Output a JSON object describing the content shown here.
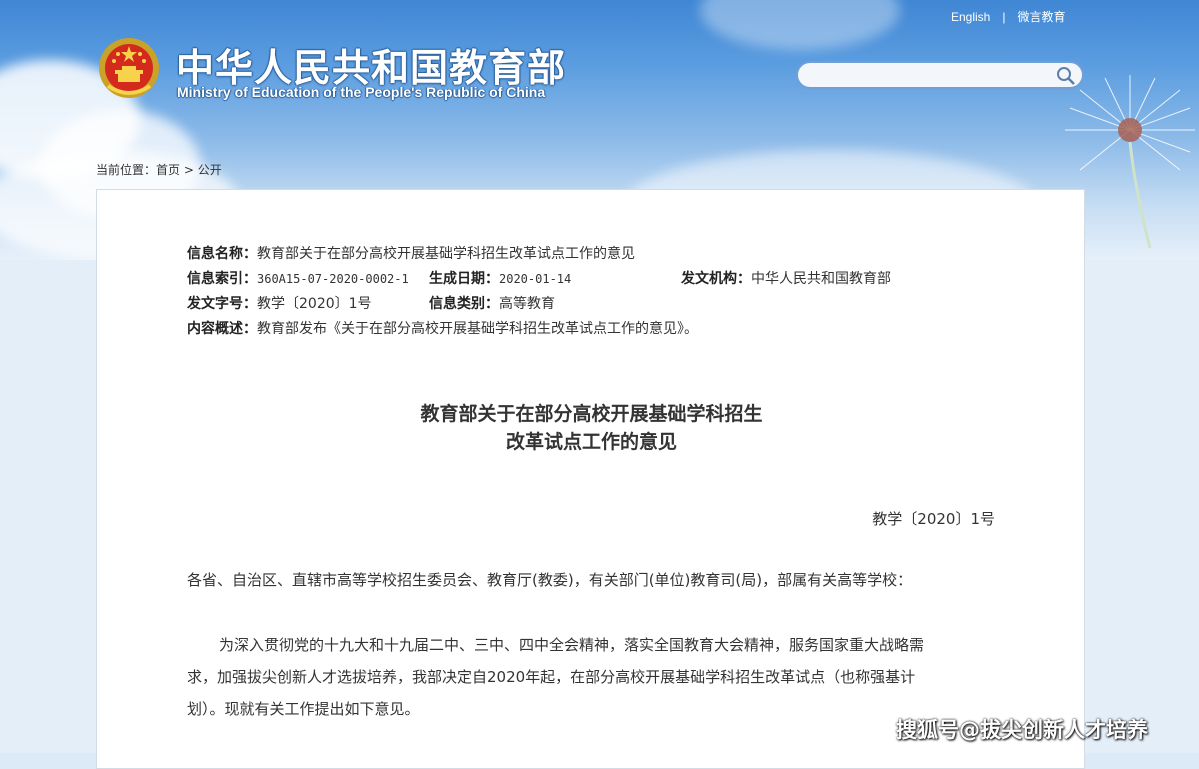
{
  "header": {
    "title_cn": "中华人民共和国教育部",
    "title_en": "Ministry of Education of the People's Republic of China",
    "links": {
      "english": "English",
      "separator": "|",
      "weixin": "微言教育"
    },
    "search": {
      "placeholder": "",
      "icon": "search-icon"
    }
  },
  "breadcrumb": {
    "prefix": "当前位置：",
    "home": "首页",
    "sep": ">",
    "current": "公开"
  },
  "meta": {
    "name_label": "信息名称：",
    "name_value": "教育部关于在部分高校开展基础学科招生改革试点工作的意见",
    "index_label": "信息索引：",
    "index_value": "360A15-07-2020-0002-1",
    "date_label": "生成日期：",
    "date_value": "2020-01-14",
    "org_label": "发文机构：",
    "org_value": "中华人民共和国教育部",
    "docno_label": "发文字号：",
    "docno_value": "教学〔2020〕1号",
    "category_label": "信息类别：",
    "category_value": "高等教育",
    "summary_label": "内容概述：",
    "summary_value": "教育部发布《关于在部分高校开展基础学科招生改革试点工作的意见》。"
  },
  "document": {
    "title_line1": "教育部关于在部分高校开展基础学科招生",
    "title_line2": "改革试点工作的意见",
    "doc_number": "教学〔2020〕1号",
    "salutation": "各省、自治区、直辖市高等学校招生委员会、教育厅(教委)，有关部门(单位)教育司(局)，部属有关高等学校：",
    "paragraph1_line1": "为深入贯彻党的十九大和十九届二中、三中、四中全会精神，落实全国教育大会精神，服务国家重大战略需",
    "paragraph1_line2": "求，加强拔尖创新人才选拔培养，我部决定自2020年起，在部分高校开展基础学科招生改革试点（也称强基计",
    "paragraph1_line3": "划）。现就有关工作提出如下意见。"
  },
  "watermark": "搜狐号@拔尖创新人才培养",
  "colors": {
    "sky_top": "#3f86d4",
    "panel_bg": "#ffffff",
    "text": "#333333"
  }
}
